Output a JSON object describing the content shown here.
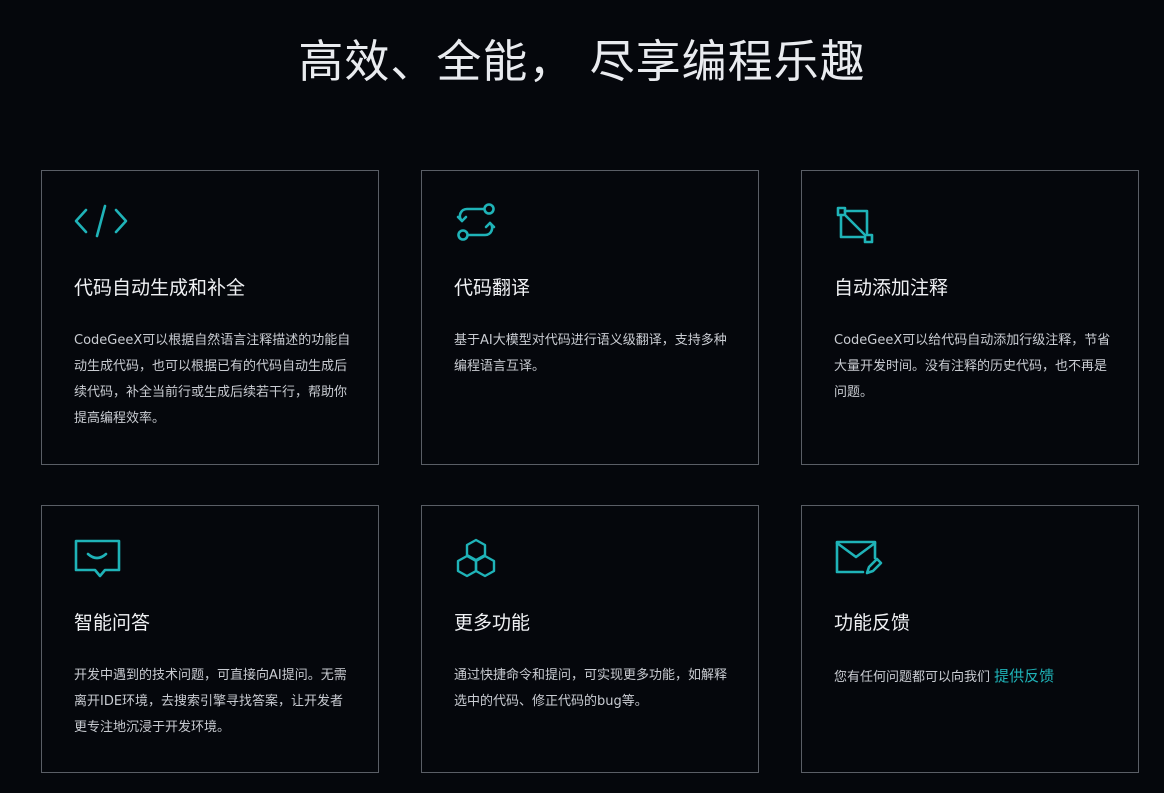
{
  "header": {
    "title": "高效、全能， 尽享编程乐趣"
  },
  "colors": {
    "accent": "#1fb3b8",
    "background": "#05070c",
    "border": "#5a5e66"
  },
  "cards": [
    {
      "icon": "code-icon",
      "title": "代码自动生成和补全",
      "desc": "CodeGeeX可以根据自然语言注释描述的功能自动生成代码，也可以根据已有的代码自动生成后续代码，补全当前行或生成后续若干行，帮助你提高编程效率。"
    },
    {
      "icon": "translate-icon",
      "title": "代码翻译",
      "desc": "基于AI大模型对代码进行语义级翻译，支持多种编程语言互译。"
    },
    {
      "icon": "comment-nodes-icon",
      "title": "自动添加注释",
      "desc": "CodeGeeX可以给代码自动添加行级注释，节省大量开发时间。没有注释的历史代码，也不再是问题。"
    },
    {
      "icon": "chat-bubble-icon",
      "title": "智能问答",
      "desc": "开发中遇到的技术问题，可直接向AI提问。无需离开IDE环境，去搜索引擎寻找答案，让开发者更专注地沉浸于开发环境。"
    },
    {
      "icon": "hexagons-icon",
      "title": "更多功能",
      "desc": "通过快捷命令和提问，可实现更多功能，如解释选中的代码、修正代码的bug等。"
    },
    {
      "icon": "mail-edit-icon",
      "title": "功能反馈",
      "desc": "您有任何问题都可以向我们 ",
      "link": "提供反馈"
    }
  ]
}
